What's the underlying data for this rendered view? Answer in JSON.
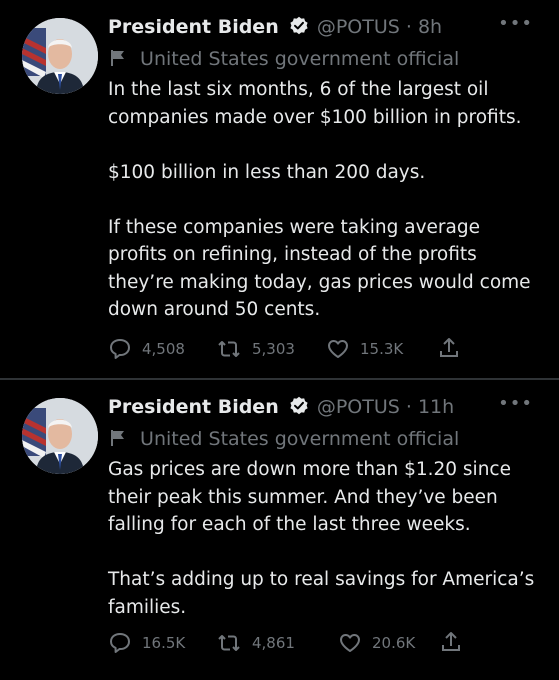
{
  "colors": {
    "background": "#000000",
    "primary_text": "#e7e9ea",
    "secondary_text": "#71767b",
    "divider": "#2f3336"
  },
  "tweets": [
    {
      "author": {
        "name": "President Biden",
        "verified_icon": "verified-badge-icon",
        "handle": "@POTUS",
        "separator": "·",
        "time": "8h"
      },
      "label": {
        "icon": "flag-icon",
        "text": "United States government official"
      },
      "paragraphs": [
        "In the last six months, 6 of the largest oil companies made over $100 billion in profits.",
        "$100 billion in less than 200 days.",
        "If these companies were taking average profits on refining, instead of the profits they’re making today, gas prices would come down around 50 cents."
      ],
      "actions": {
        "replies": "4,508",
        "retweets": "5,303",
        "likes": "15.3K"
      }
    },
    {
      "author": {
        "name": "President Biden",
        "verified_icon": "verified-badge-icon",
        "handle": "@POTUS",
        "separator": "·",
        "time": "11h"
      },
      "label": {
        "icon": "flag-icon",
        "text": "United States government official"
      },
      "paragraphs": [
        "Gas prices are down more than $1.20 since their peak this summer. And they’ve been falling for each of the last three weeks.",
        "That’s adding up to real savings for America’s families."
      ],
      "actions": {
        "replies": "16.5K",
        "retweets": "4,861",
        "likes": "20.6K"
      }
    }
  ]
}
